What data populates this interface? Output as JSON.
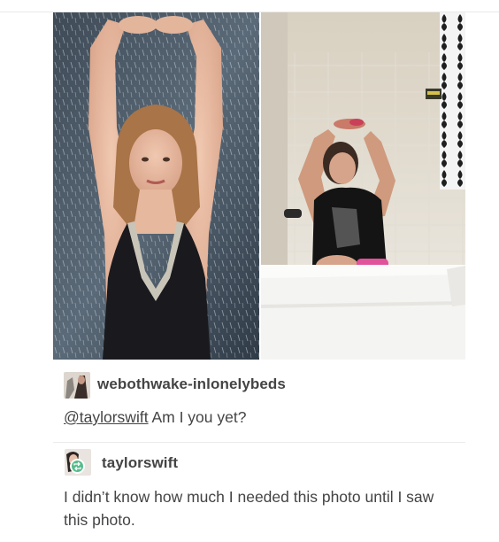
{
  "post": {
    "photos": [
      {
        "subject": "woman-in-rain-photo"
      },
      {
        "subject": "person-in-bathtub-photo"
      }
    ],
    "reblogs": [
      {
        "username": "webothwake-inlonelybeds",
        "mention": "@taylorswift",
        "text": " Am I you yet?"
      },
      {
        "username": "taylorswift",
        "badge_icon": "reblog-icon",
        "badge_color": "#56bc8a",
        "text": "I didn’t know how much I needed this photo until I saw this photo."
      }
    ]
  },
  "colors": {
    "text": "#444444",
    "divider": "#ececec",
    "background": "#ffffff"
  }
}
